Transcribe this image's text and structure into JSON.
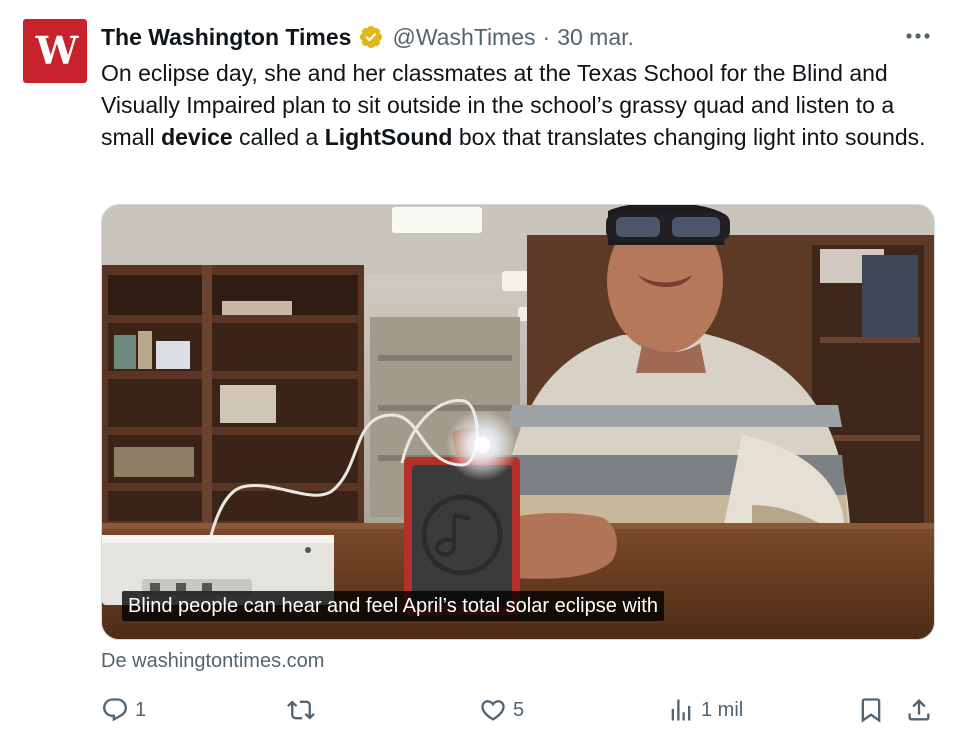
{
  "tweet": {
    "author_name": "The Washington Times",
    "handle": "@WashTimes",
    "separator": "·",
    "time": "30 mar.",
    "avatar_label": "W",
    "text_parts": [
      "On eclipse day, she and her classmates at the Texas School for the Blind and Visually Impaired plan to sit outside in the school’s grassy quad and listen to a small ",
      "device",
      " called a ",
      "LightSound",
      " box that translates changing light into sounds."
    ],
    "media": {
      "caption": "Blind people can hear and feel April’s total solar eclipse with"
    },
    "source": "De washingtontimes.com"
  },
  "actions": {
    "reply_count": "1",
    "repost_count": "",
    "like_count": "5",
    "views_count": "1 mil"
  },
  "icons": {
    "verified": "verified-badge-icon",
    "more": "more-icon",
    "reply": "reply-icon",
    "repost": "repost-icon",
    "like": "heart-icon",
    "views": "views-icon",
    "bookmark": "bookmark-icon",
    "share": "share-icon"
  },
  "colors": {
    "brand_red": "#c8232c",
    "verified_gold": "#e2b719",
    "secondary_text": "#536471",
    "primary_text": "#0f1419"
  }
}
